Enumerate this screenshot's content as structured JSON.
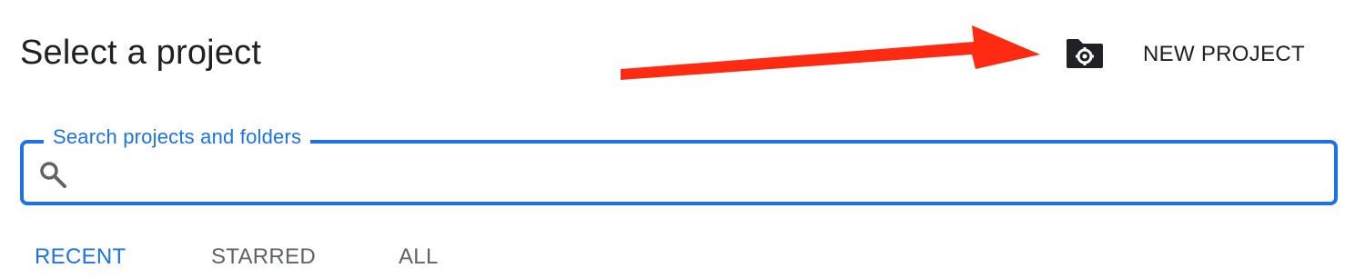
{
  "dialog": {
    "title": "Select a project"
  },
  "toolbar": {
    "new_project_label": "NEW PROJECT",
    "new_project_icon": "folder-settings-icon"
  },
  "search": {
    "label": "Search projects and folders",
    "value": "",
    "placeholder": "",
    "icon": "search-icon"
  },
  "tabs": [
    {
      "label": "RECENT",
      "selected": true
    },
    {
      "label": "STARRED",
      "selected": false
    },
    {
      "label": "ALL",
      "selected": false
    }
  ],
  "colors": {
    "accent": "#1a73e8",
    "text_primary": "#202124",
    "text_secondary": "#5f6368",
    "annotation_arrow": "#ff2a12"
  }
}
